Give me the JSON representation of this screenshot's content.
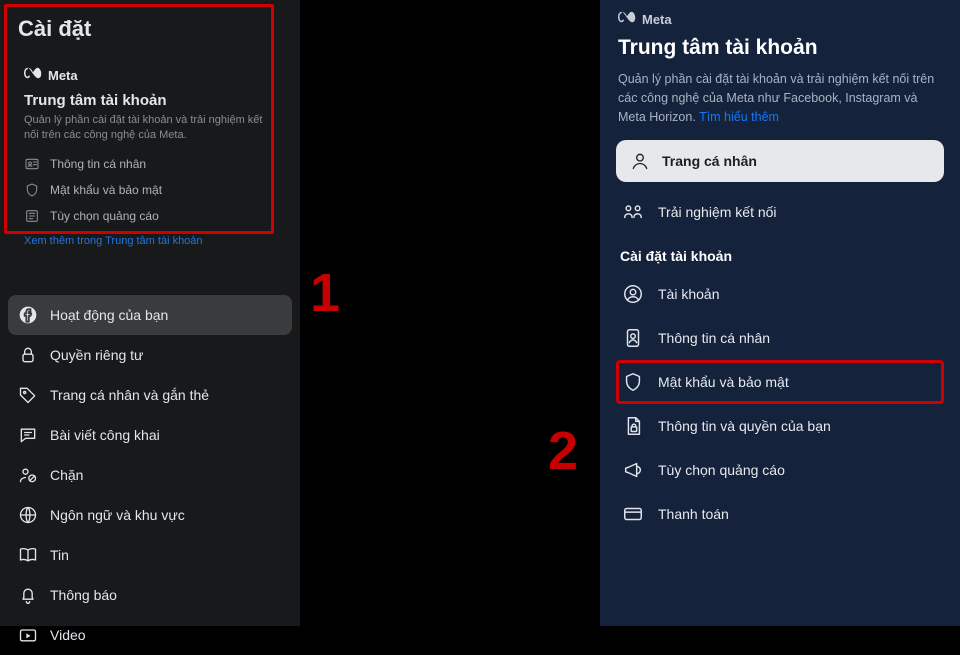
{
  "left": {
    "title": "Cài đặt",
    "brand": "Meta",
    "card": {
      "title": "Trung tâm tài khoản",
      "desc": "Quản lý phần cài đặt tài khoản và trải nghiệm kết nối trên các công nghệ của Meta.",
      "items": [
        {
          "label": "Thông tin cá nhân"
        },
        {
          "label": "Mật khẩu và bảo mật"
        },
        {
          "label": "Tùy chọn quảng cáo"
        }
      ],
      "more": "Xem thêm trong Trung tâm tài khoản"
    },
    "menu": [
      {
        "label": "Hoạt động của bạn"
      },
      {
        "label": "Quyền riêng tư"
      },
      {
        "label": "Trang cá nhân và gắn thẻ"
      },
      {
        "label": "Bài viết công khai"
      },
      {
        "label": "Chặn"
      },
      {
        "label": "Ngôn ngữ và khu vực"
      },
      {
        "label": "Tin"
      },
      {
        "label": "Thông báo"
      },
      {
        "label": "Video"
      }
    ]
  },
  "right": {
    "brand": "Meta",
    "title": "Trung tâm tài khoản",
    "desc_a": "Quản lý phần cài đặt tài khoản và trải nghiệm kết nối trên các công nghệ của Meta như Facebook, Instagram và Meta Horizon. ",
    "desc_link": "Tìm hiểu thêm",
    "profile_btn": "Trang cá nhân",
    "connected_exp": "Trải nghiệm kết nối",
    "section_header": "Cài đặt tài khoản",
    "items": [
      {
        "label": "Tài khoản"
      },
      {
        "label": "Thông tin cá nhân"
      },
      {
        "label": "Mật khẩu và bảo mật"
      },
      {
        "label": "Thông tin và quyền của bạn"
      },
      {
        "label": "Tùy chọn quảng cáo"
      },
      {
        "label": "Thanh toán"
      }
    ]
  },
  "annotations": {
    "one": "1",
    "two": "2"
  }
}
